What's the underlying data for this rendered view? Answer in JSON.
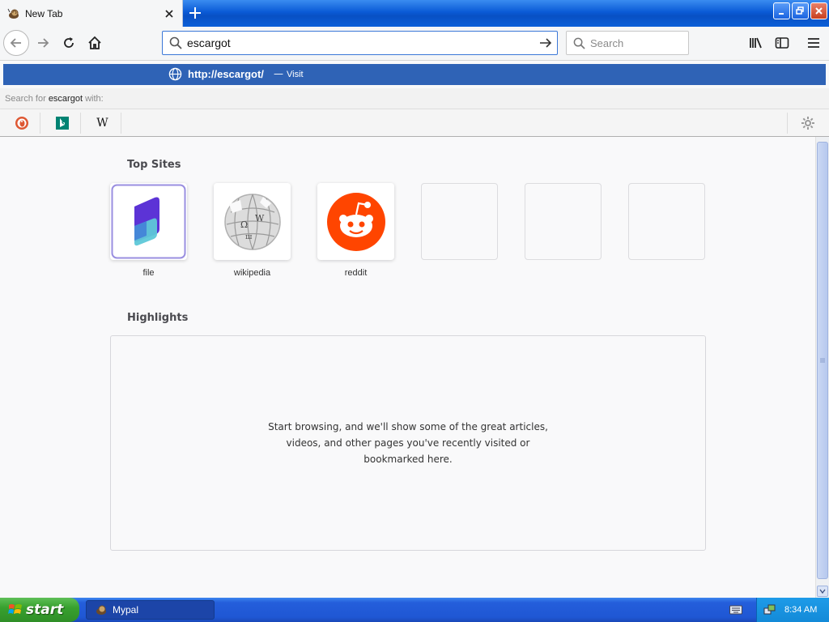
{
  "window": {
    "tab_title": "New Tab",
    "new_tab_symbol": "+"
  },
  "navbar": {
    "url_value": "escargot",
    "search_placeholder": "Search"
  },
  "dropdown": {
    "visit_url": "http://escargot/",
    "visit_separator": "—",
    "visit_action": "Visit",
    "search_for_prefix": "Search for ",
    "search_for_term": "escargot",
    "search_for_suffix": " with:",
    "engines": [
      {
        "name": "duckduckgo-icon"
      },
      {
        "name": "bing-icon"
      },
      {
        "name": "wikipedia-icon",
        "glyph": "W"
      }
    ]
  },
  "content": {
    "top_sites_title": "Top Sites",
    "top_sites": [
      {
        "label": "file",
        "icon": "file-icon"
      },
      {
        "label": "wikipedia",
        "icon": "wikipedia-globe-icon"
      },
      {
        "label": "reddit",
        "icon": "reddit-icon"
      },
      {
        "label": "",
        "icon": ""
      },
      {
        "label": "",
        "icon": ""
      },
      {
        "label": "",
        "icon": ""
      }
    ],
    "highlights_title": "Highlights",
    "highlights_message": "Start browsing, and we'll show some of the great articles, videos, and other pages you've recently visited or bookmarked here."
  },
  "taskbar": {
    "start_label": "start",
    "task_label": "Mypal",
    "clock": "8:34 AM"
  },
  "colors": {
    "accent": "#2f63b6",
    "reddit": "#ff4500",
    "xp_blue": "#245edb",
    "start_green": "#38a12f"
  }
}
